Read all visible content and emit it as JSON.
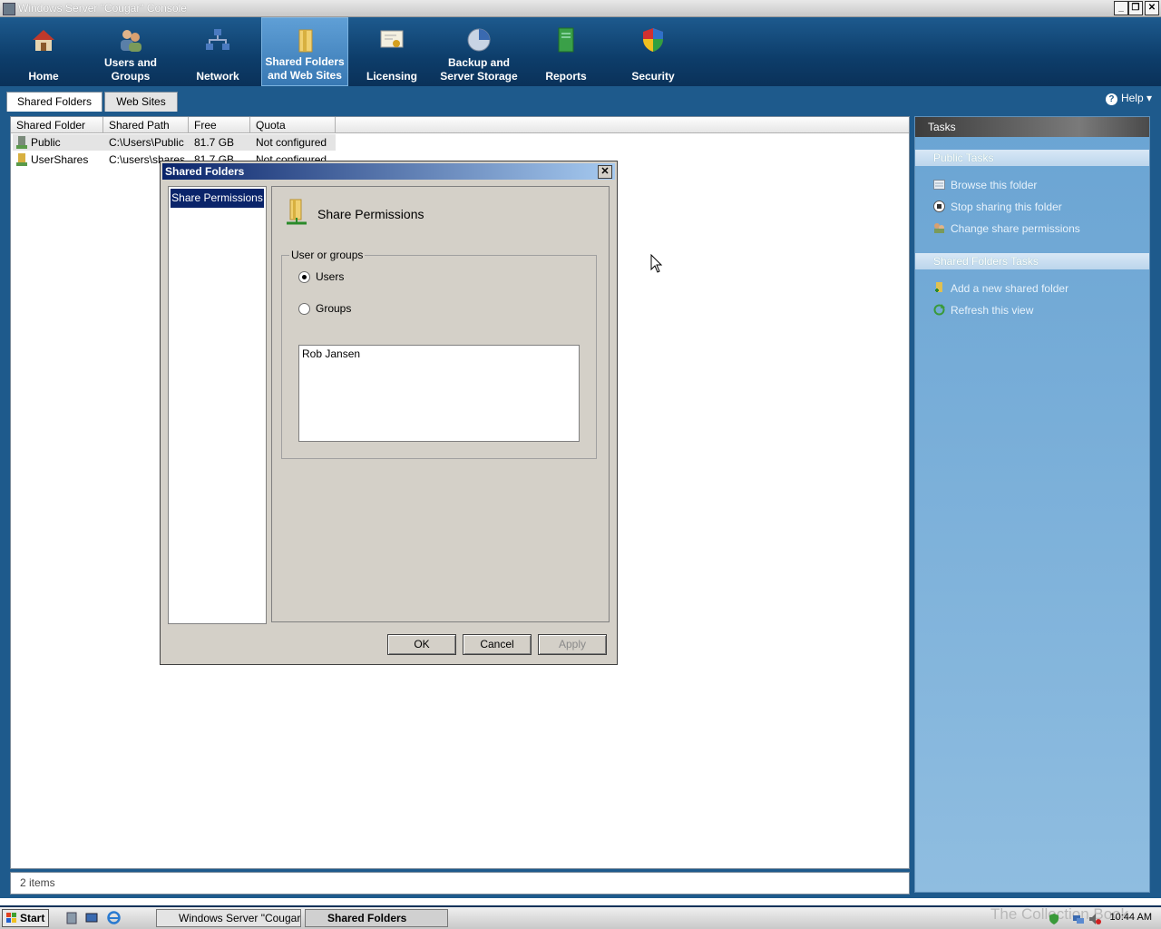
{
  "window": {
    "title": "Windows Server \"Cougar\" Console"
  },
  "nav": [
    {
      "line1": "Home",
      "line2": ""
    },
    {
      "line1": "Users and",
      "line2": "Groups"
    },
    {
      "line1": "Network",
      "line2": ""
    },
    {
      "line1": "Shared Folders",
      "line2": "and Web Sites"
    },
    {
      "line1": "Licensing",
      "line2": ""
    },
    {
      "line1": "Backup and",
      "line2": "Server Storage"
    },
    {
      "line1": "Reports",
      "line2": ""
    },
    {
      "line1": "Security",
      "line2": ""
    }
  ],
  "tabs": {
    "shared_folders": "Shared Folders",
    "web_sites": "Web Sites"
  },
  "help": {
    "label": "Help"
  },
  "table": {
    "headers": [
      "Shared Folder",
      "Shared Path",
      "Free Space",
      "Quota"
    ],
    "rows": [
      {
        "name": "Public",
        "path": "C:\\Users\\Public",
        "free": "81.7 GB",
        "quota": "Not configured"
      },
      {
        "name": "UserShares",
        "path": "C:\\users\\shares",
        "free": "81.7 GB",
        "quota": "Not configured"
      }
    ]
  },
  "status": {
    "items": "2 items"
  },
  "tasks": {
    "title": "Tasks",
    "public_title": "Public Tasks",
    "public_items": [
      "Browse this folder",
      "Stop sharing this folder",
      "Change share permissions"
    ],
    "shared_title": "Shared Folders Tasks",
    "shared_items": [
      "Add a new shared folder",
      "Refresh this view"
    ]
  },
  "dialog": {
    "title": "Shared Folders",
    "nav_item": "Share Permissions",
    "heading": "Share Permissions",
    "group_label": "User or groups",
    "radio_users": "Users",
    "radio_groups": "Groups",
    "selected": "users",
    "list": [
      "Rob Jansen"
    ],
    "ok": "OK",
    "cancel": "Cancel",
    "apply": "Apply"
  },
  "taskbar": {
    "start": "Start",
    "items": [
      "Windows Server \"Cougar...",
      "Shared Folders"
    ],
    "clock": "10:44 AM",
    "watermark": "The Collection Book"
  },
  "colors": {
    "ribbon": "#0d3d6a",
    "selected_nav": "#3878b3",
    "dialog_title": "#0a246a",
    "task_pane": "#7aaedb"
  }
}
